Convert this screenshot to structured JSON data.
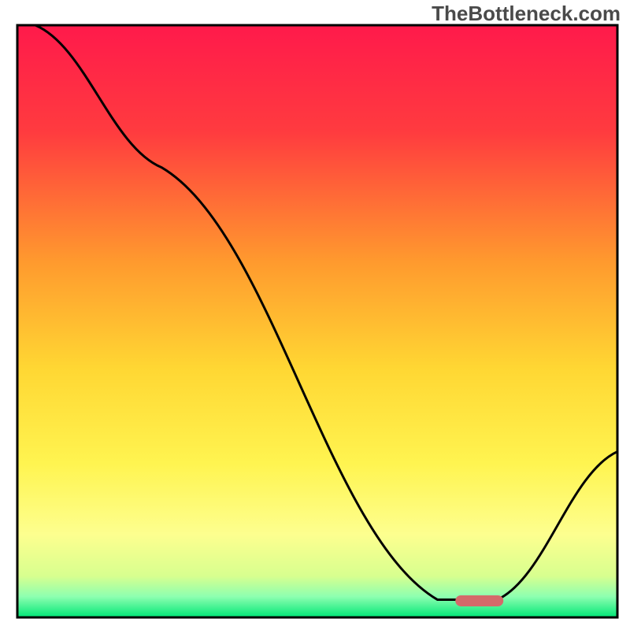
{
  "watermark": "TheBottleneck.com",
  "chart_data": {
    "type": "line",
    "title": "",
    "xlabel": "",
    "ylabel": "",
    "xlim": [
      0,
      100
    ],
    "ylim": [
      0,
      100
    ],
    "background_gradient_stops": [
      {
        "offset": 0.0,
        "color": "#ff1a4b"
      },
      {
        "offset": 0.18,
        "color": "#ff3b3f"
      },
      {
        "offset": 0.4,
        "color": "#ff9a2e"
      },
      {
        "offset": 0.58,
        "color": "#ffd733"
      },
      {
        "offset": 0.74,
        "color": "#fff450"
      },
      {
        "offset": 0.86,
        "color": "#fdff8f"
      },
      {
        "offset": 0.93,
        "color": "#d8ff8f"
      },
      {
        "offset": 0.965,
        "color": "#8dffb0"
      },
      {
        "offset": 1.0,
        "color": "#00e676"
      }
    ],
    "series": [
      {
        "name": "bottleneck-curve",
        "x": [
          3,
          24,
          70,
          80,
          100
        ],
        "y": [
          100,
          76,
          3,
          3,
          28
        ]
      }
    ],
    "marker": {
      "name": "optimal-range",
      "x_center": 77,
      "y": 2.8,
      "width": 8,
      "color": "#d46a6a"
    }
  }
}
